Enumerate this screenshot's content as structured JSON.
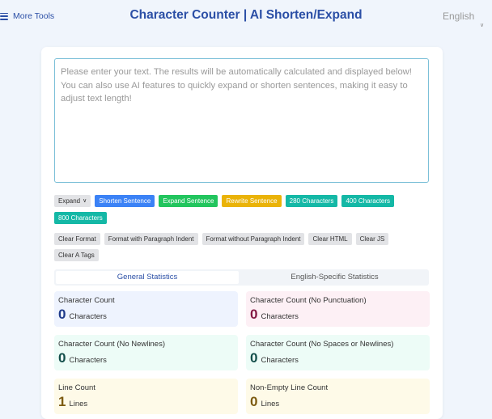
{
  "header": {
    "more_tools": "More Tools",
    "title": "Character Counter | AI Shorten/Expand",
    "language": "English"
  },
  "editor": {
    "placeholder": "Please enter your text. The results will be automatically calculated and displayed below! You can also use AI features to quickly expand or shorten sentences, making it easy to adjust text length!",
    "value": ""
  },
  "ai_buttons": {
    "mode_select": "Expand",
    "shorten": "Shorten Sentence",
    "expand": "Expand Sentence",
    "rewrite": "Rewrite Sentence",
    "c280": "280 Characters",
    "c400": "400 Characters",
    "c800": "800 Characters"
  },
  "format_buttons": {
    "clear_format": "Clear Format",
    "format_indent": "Format with Paragraph Indent",
    "format_no_indent": "Format without Paragraph Indent",
    "clear_html": "Clear HTML",
    "clear_js": "Clear JS",
    "clear_a_tags": "Clear A Tags"
  },
  "tabs": {
    "general": "General Statistics",
    "english": "English-Specific Statistics"
  },
  "stats": [
    {
      "label": "Character Count",
      "value": "0",
      "unit": "Characters",
      "bg": "#eef3fe",
      "color": "#1e3a8a"
    },
    {
      "label": "Character Count (No Punctuation)",
      "value": "0",
      "unit": "Characters",
      "bg": "#fdf0f5",
      "color": "#831843"
    },
    {
      "label": "Character Count (No Newlines)",
      "value": "0",
      "unit": "Characters",
      "bg": "#edfcf7",
      "color": "#134e4a"
    },
    {
      "label": "Character Count (No Spaces or Newlines)",
      "value": "0",
      "unit": "Characters",
      "bg": "#edfcf7",
      "color": "#134e4a"
    },
    {
      "label": "Line Count",
      "value": "1",
      "unit": "Lines",
      "bg": "#fefae8",
      "color": "#7c5a10"
    },
    {
      "label": "Non-Empty Line Count",
      "value": "0",
      "unit": "Lines",
      "bg": "#fefae8",
      "color": "#7c5a10"
    }
  ]
}
